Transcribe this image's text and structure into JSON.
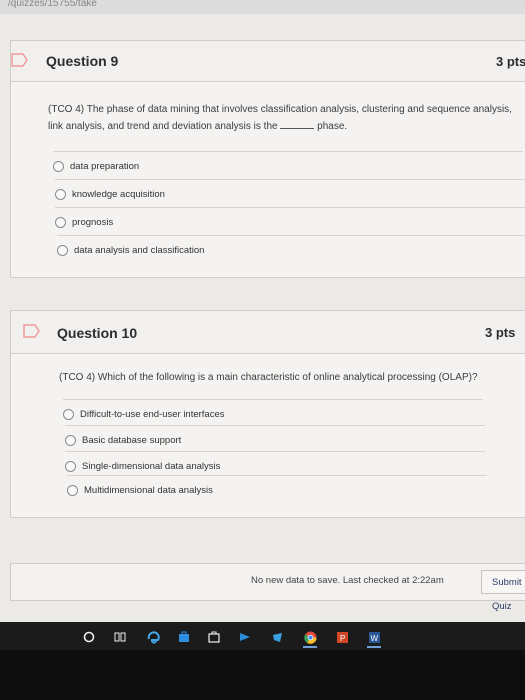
{
  "browser": {
    "url_fragment": "/quizzes/15755/take"
  },
  "questions": [
    {
      "title": "Question 9",
      "points": "3 pts",
      "text_before_blank": "(TCO 4) The phase of data mining that involves classification analysis, clustering and sequence analysis, link analysis, and trend and deviation analysis is the",
      "text_after_blank": "phase.",
      "answers": [
        "data preparation",
        "knowledge acquisition",
        "prognosis",
        "data analysis and classification"
      ]
    },
    {
      "title": "Question 10",
      "points": "3 pts",
      "text": "(TCO 4) Which of the following is a main characteristic of online analytical processing (OLAP)?",
      "answers": [
        "Difficult-to-use end-user interfaces",
        "Basic database support",
        "Single-dimensional data analysis",
        "Multidimensional data analysis"
      ]
    }
  ],
  "footer": {
    "status": "No new data to save. Last checked at 2:22am",
    "submit_label": "Submit Quiz"
  },
  "taskbar": {
    "icons": [
      "search-icon",
      "task-view-icon",
      "edge-icon",
      "store-icon",
      "briefcase-icon",
      "mail-icon",
      "game-icon",
      "chrome-icon",
      "powerpoint-icon",
      "word-icon"
    ]
  },
  "colors": {
    "flag": "#ef9a9a",
    "submit_text": "#2d3b6b",
    "taskbar": "#1b1b1b"
  }
}
